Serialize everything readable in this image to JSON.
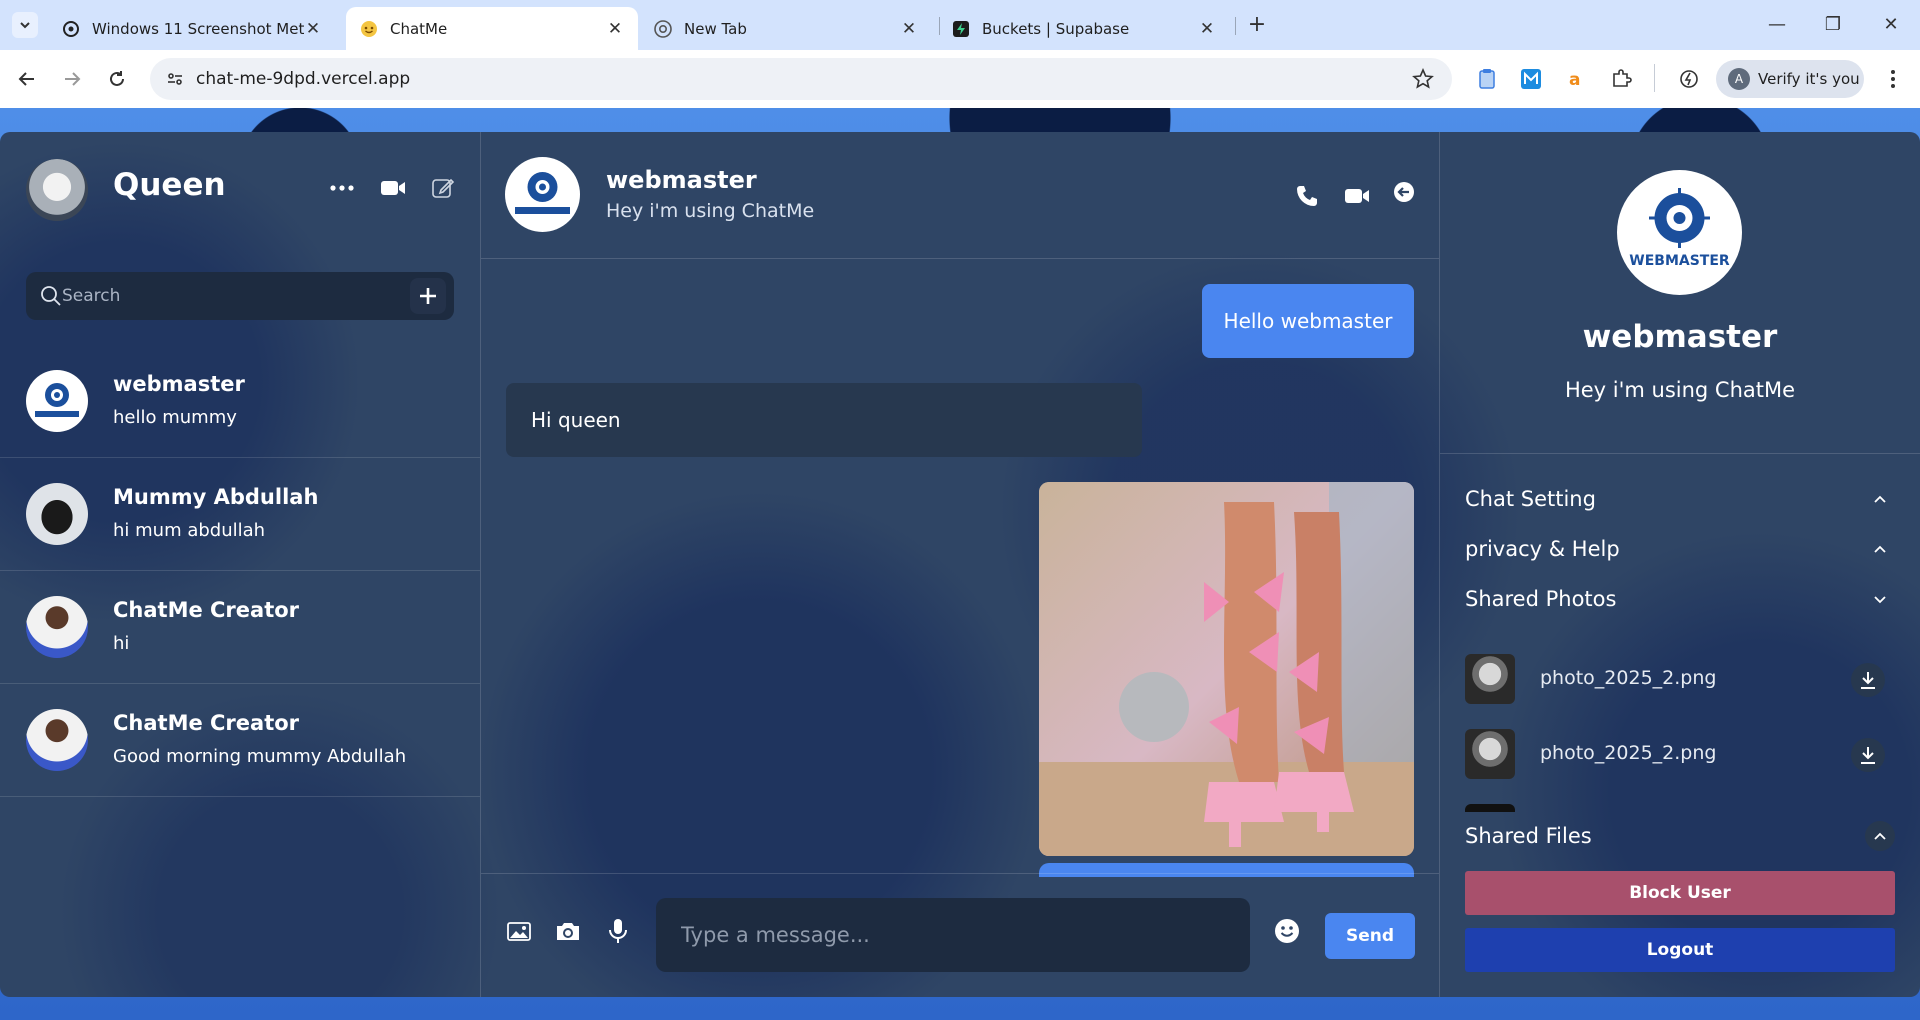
{
  "browser": {
    "tabs": [
      {
        "title": "Windows 11 Screenshot Metho",
        "icon": "openai-icon",
        "active": false
      },
      {
        "title": "ChatMe",
        "icon": "chatme-icon",
        "active": true
      },
      {
        "title": "New Tab",
        "icon": "chrome-icon",
        "active": false
      },
      {
        "title": "Buckets | Supabase",
        "icon": "supabase-icon",
        "active": false
      }
    ],
    "url": "chat-me-9dpd.vercel.app",
    "verify_label": "Verify it's you",
    "profile_initial": "A"
  },
  "sidebar": {
    "user_name": "Queen",
    "search_placeholder": "Search",
    "contacts": [
      {
        "name": "webmaster",
        "last_message": "hello mummy"
      },
      {
        "name": "Mummy Abdullah",
        "last_message": "hi mum abdullah"
      },
      {
        "name": "ChatMe Creator",
        "last_message": "hi"
      },
      {
        "name": "ChatMe Creator",
        "last_message": "Good morning mummy Abdullah"
      }
    ]
  },
  "chat": {
    "name": "webmaster",
    "status": "Hey i'm using ChatMe",
    "messages": [
      {
        "from": "me",
        "text": "Hello webmaster"
      },
      {
        "from": "them",
        "text": "Hi queen"
      }
    ],
    "input_placeholder": "Type a message...",
    "send_label": "Send"
  },
  "profile": {
    "name": "webmaster",
    "status": "Hey i'm using ChatMe",
    "logo_text": "WEBMASTER",
    "sections": {
      "chat_setting": "Chat Setting",
      "privacy_help": "privacy & Help",
      "shared_photos": "Shared Photos",
      "shared_files": "Shared Files"
    },
    "photos": [
      {
        "name": "photo_2025_2.png"
      },
      {
        "name": "photo_2025_2.png"
      }
    ],
    "block_label": "Block User",
    "logout_label": "Logout"
  },
  "colors": {
    "accent": "#4a86f0",
    "panel": "#2f4565",
    "block": "#a8506c",
    "logout": "#1e40af"
  }
}
